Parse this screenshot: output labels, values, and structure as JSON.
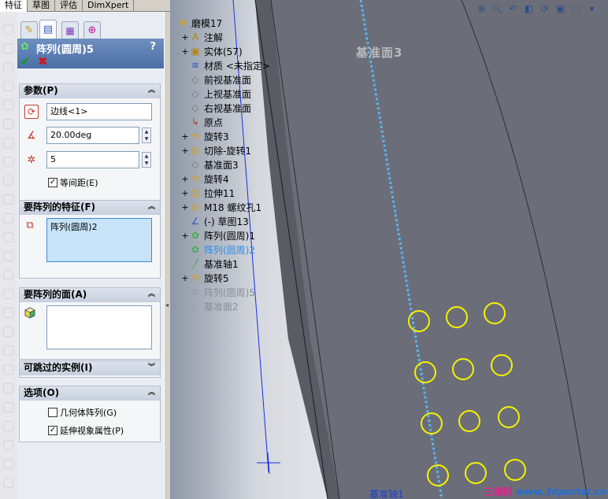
{
  "tabs": [
    {
      "label": "特征"
    },
    {
      "label": "草图"
    },
    {
      "label": "评估"
    },
    {
      "label": "DimXpert"
    }
  ],
  "pm": {
    "title": "阵列(圆周)5",
    "help": "?",
    "ok": "✔",
    "cancel": "✖",
    "params": {
      "header": "参数(P)",
      "edge": "边线<1>",
      "angle": "20.00deg",
      "count": "5",
      "equal_spacing": "等间距(E)"
    },
    "features": {
      "header": "要阵列的特征(F)",
      "item": "阵列(圆周)2"
    },
    "faces": {
      "header": "要阵列的面(A)"
    },
    "skip": {
      "header": "可跳过的实例(I)"
    },
    "options": {
      "header": "选项(O)",
      "geometry": "几何体阵列(G)",
      "propagate": "延伸视象属性(P)"
    }
  },
  "tree": {
    "root": "磨模17",
    "items": [
      {
        "label": "注解",
        "icon": "annotation-icon",
        "exp": "+"
      },
      {
        "label": "实体(57)",
        "icon": "solid-bodies-icon",
        "exp": "+"
      },
      {
        "label": "材质 <未指定>",
        "icon": "material-icon",
        "exp": ""
      },
      {
        "label": "前视基准面",
        "icon": "plane-icon",
        "exp": ""
      },
      {
        "label": "上视基准面",
        "icon": "plane-icon",
        "exp": ""
      },
      {
        "label": "右视基准面",
        "icon": "plane-icon",
        "exp": ""
      },
      {
        "label": "原点",
        "icon": "origin-icon",
        "exp": ""
      },
      {
        "label": "旋转3",
        "icon": "revolve-icon",
        "exp": "+"
      },
      {
        "label": "切除-旋转1",
        "icon": "cut-revolve-icon",
        "exp": "+"
      },
      {
        "label": "基准面3",
        "icon": "plane-icon",
        "exp": ""
      },
      {
        "label": "旋转4",
        "icon": "revolve-icon",
        "exp": "+"
      },
      {
        "label": "拉伸11",
        "icon": "extrude-icon",
        "exp": "+"
      },
      {
        "label": "M18 螺纹孔1",
        "icon": "hole-icon",
        "exp": "+"
      },
      {
        "label": "(-) 草图13",
        "icon": "sketch-icon",
        "exp": ""
      },
      {
        "label": "阵列(圆周)1",
        "icon": "circular-pattern-icon",
        "exp": "+"
      },
      {
        "label": "阵列(圆周)2",
        "icon": "circular-pattern-icon",
        "exp": "",
        "style": "hl"
      },
      {
        "label": "基准轴1",
        "icon": "axis-icon",
        "exp": ""
      },
      {
        "label": "旋转5",
        "icon": "revolve-icon",
        "exp": "+"
      },
      {
        "label": "阵列(圆周)5",
        "icon": "circular-pattern-icon",
        "exp": "",
        "style": "dim"
      },
      {
        "label": "基准面2",
        "icon": "plane-icon",
        "exp": "",
        "style": "dim"
      }
    ]
  },
  "viewport": {
    "ghost_label": "基准面3",
    "axis_label": "基准轴1"
  },
  "watermark": {
    "part1": "三维网",
    "part2": "www.3dportal.cn"
  }
}
